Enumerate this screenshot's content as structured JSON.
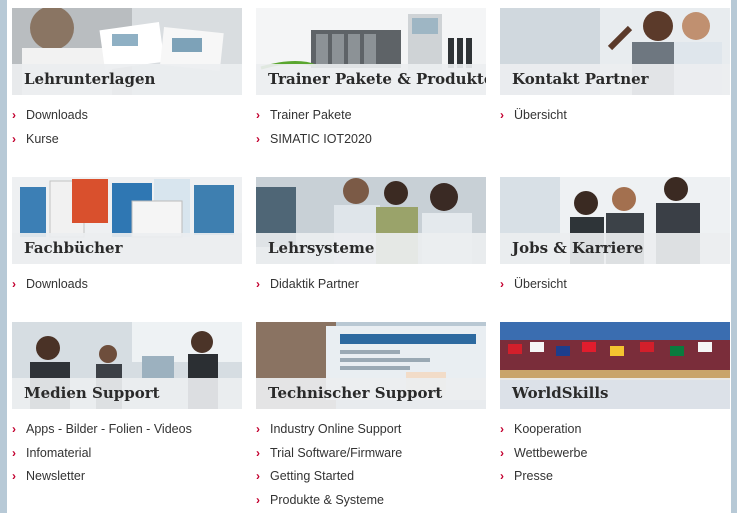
{
  "tiles": [
    {
      "title": "Lehrunterlagen",
      "links": [
        "Downloads",
        "Kurse"
      ]
    },
    {
      "title": "Trainer Pakete & Produkte",
      "links": [
        "Trainer Pakete",
        "SIMATIC IOT2020"
      ]
    },
    {
      "title": "Kontakt Partner",
      "links": [
        "Übersicht"
      ]
    },
    {
      "title": "Fachbücher",
      "links": [
        "Downloads"
      ]
    },
    {
      "title": "Lehrsysteme",
      "links": [
        "Didaktik Partner"
      ]
    },
    {
      "title": "Jobs & Karriere",
      "links": [
        "Übersicht"
      ]
    },
    {
      "title": "Medien Support",
      "links": [
        "Apps - Bilder - Folien - Videos",
        "Infomaterial",
        "Newsletter"
      ]
    },
    {
      "title": "Technischer Support",
      "links": [
        "Industry Online Support",
        "Trial Software/Firmware",
        "Getting Started",
        "Produkte & Systeme"
      ]
    },
    {
      "title": "WorldSkills",
      "links": [
        "Kooperation",
        "Wettbewerbe",
        "Presse"
      ]
    }
  ],
  "link_marker": "›",
  "colors": {
    "accent": "#c3002f",
    "caption_bg": "#eceef0",
    "frame": "#b7c9d6"
  }
}
